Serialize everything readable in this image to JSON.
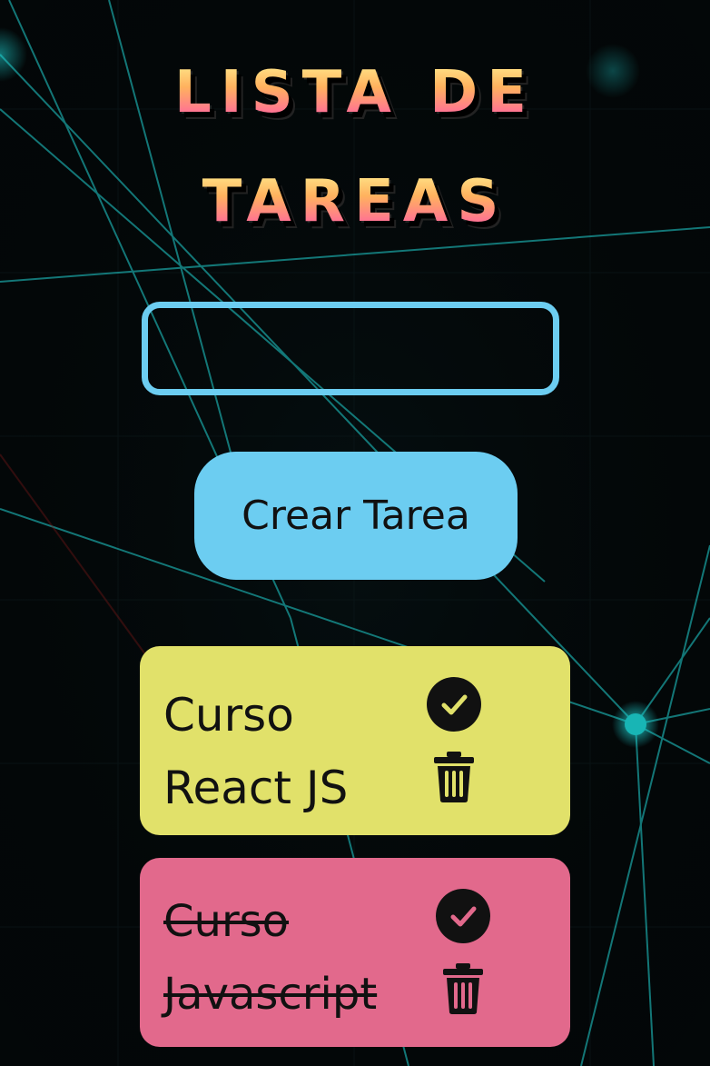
{
  "app": {
    "title_line1": "LISTA DE",
    "title_line2": "TAREAS"
  },
  "form": {
    "input_value": "",
    "input_placeholder": "",
    "create_button_label": "Crear Tarea"
  },
  "tasks": [
    {
      "text": "Curso React JS",
      "completed": false,
      "color": "#e1e16a",
      "complete_icon": "check-circle-icon",
      "delete_icon": "trash-icon"
    },
    {
      "text": "Curso Javascript",
      "completed": true,
      "color": "#e2698c",
      "complete_icon": "check-circle-icon",
      "delete_icon": "trash-icon"
    }
  ],
  "theme": {
    "background": "#030708",
    "accent": "#6ccdf1",
    "network_lines": "#1aa6a6"
  }
}
